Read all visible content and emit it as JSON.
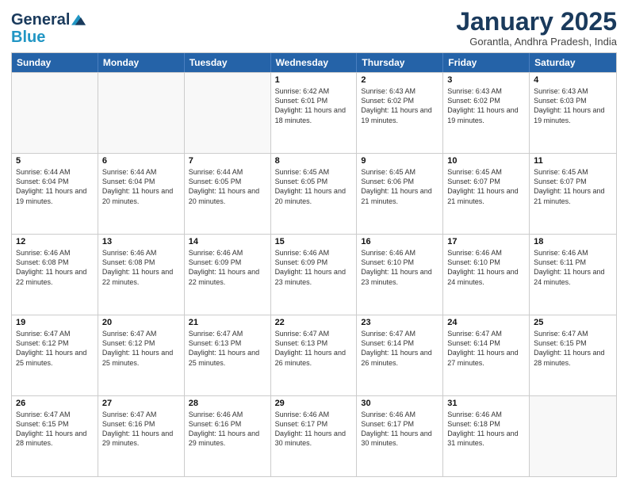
{
  "logo": {
    "line1": "General",
    "line2": "Blue"
  },
  "title": "January 2025",
  "subtitle": "Gorantla, Andhra Pradesh, India",
  "days_of_week": [
    "Sunday",
    "Monday",
    "Tuesday",
    "Wednesday",
    "Thursday",
    "Friday",
    "Saturday"
  ],
  "weeks": [
    [
      {
        "day": "",
        "info": "",
        "empty": true
      },
      {
        "day": "",
        "info": "",
        "empty": true
      },
      {
        "day": "",
        "info": "",
        "empty": true
      },
      {
        "day": "1",
        "info": "Sunrise: 6:42 AM\nSunset: 6:01 PM\nDaylight: 11 hours and 18 minutes."
      },
      {
        "day": "2",
        "info": "Sunrise: 6:43 AM\nSunset: 6:02 PM\nDaylight: 11 hours and 19 minutes."
      },
      {
        "day": "3",
        "info": "Sunrise: 6:43 AM\nSunset: 6:02 PM\nDaylight: 11 hours and 19 minutes."
      },
      {
        "day": "4",
        "info": "Sunrise: 6:43 AM\nSunset: 6:03 PM\nDaylight: 11 hours and 19 minutes."
      }
    ],
    [
      {
        "day": "5",
        "info": "Sunrise: 6:44 AM\nSunset: 6:04 PM\nDaylight: 11 hours and 19 minutes."
      },
      {
        "day": "6",
        "info": "Sunrise: 6:44 AM\nSunset: 6:04 PM\nDaylight: 11 hours and 20 minutes."
      },
      {
        "day": "7",
        "info": "Sunrise: 6:44 AM\nSunset: 6:05 PM\nDaylight: 11 hours and 20 minutes."
      },
      {
        "day": "8",
        "info": "Sunrise: 6:45 AM\nSunset: 6:05 PM\nDaylight: 11 hours and 20 minutes."
      },
      {
        "day": "9",
        "info": "Sunrise: 6:45 AM\nSunset: 6:06 PM\nDaylight: 11 hours and 21 minutes."
      },
      {
        "day": "10",
        "info": "Sunrise: 6:45 AM\nSunset: 6:07 PM\nDaylight: 11 hours and 21 minutes."
      },
      {
        "day": "11",
        "info": "Sunrise: 6:45 AM\nSunset: 6:07 PM\nDaylight: 11 hours and 21 minutes."
      }
    ],
    [
      {
        "day": "12",
        "info": "Sunrise: 6:46 AM\nSunset: 6:08 PM\nDaylight: 11 hours and 22 minutes."
      },
      {
        "day": "13",
        "info": "Sunrise: 6:46 AM\nSunset: 6:08 PM\nDaylight: 11 hours and 22 minutes."
      },
      {
        "day": "14",
        "info": "Sunrise: 6:46 AM\nSunset: 6:09 PM\nDaylight: 11 hours and 22 minutes."
      },
      {
        "day": "15",
        "info": "Sunrise: 6:46 AM\nSunset: 6:09 PM\nDaylight: 11 hours and 23 minutes."
      },
      {
        "day": "16",
        "info": "Sunrise: 6:46 AM\nSunset: 6:10 PM\nDaylight: 11 hours and 23 minutes."
      },
      {
        "day": "17",
        "info": "Sunrise: 6:46 AM\nSunset: 6:10 PM\nDaylight: 11 hours and 24 minutes."
      },
      {
        "day": "18",
        "info": "Sunrise: 6:46 AM\nSunset: 6:11 PM\nDaylight: 11 hours and 24 minutes."
      }
    ],
    [
      {
        "day": "19",
        "info": "Sunrise: 6:47 AM\nSunset: 6:12 PM\nDaylight: 11 hours and 25 minutes."
      },
      {
        "day": "20",
        "info": "Sunrise: 6:47 AM\nSunset: 6:12 PM\nDaylight: 11 hours and 25 minutes."
      },
      {
        "day": "21",
        "info": "Sunrise: 6:47 AM\nSunset: 6:13 PM\nDaylight: 11 hours and 25 minutes."
      },
      {
        "day": "22",
        "info": "Sunrise: 6:47 AM\nSunset: 6:13 PM\nDaylight: 11 hours and 26 minutes."
      },
      {
        "day": "23",
        "info": "Sunrise: 6:47 AM\nSunset: 6:14 PM\nDaylight: 11 hours and 26 minutes."
      },
      {
        "day": "24",
        "info": "Sunrise: 6:47 AM\nSunset: 6:14 PM\nDaylight: 11 hours and 27 minutes."
      },
      {
        "day": "25",
        "info": "Sunrise: 6:47 AM\nSunset: 6:15 PM\nDaylight: 11 hours and 28 minutes."
      }
    ],
    [
      {
        "day": "26",
        "info": "Sunrise: 6:47 AM\nSunset: 6:15 PM\nDaylight: 11 hours and 28 minutes."
      },
      {
        "day": "27",
        "info": "Sunrise: 6:47 AM\nSunset: 6:16 PM\nDaylight: 11 hours and 29 minutes."
      },
      {
        "day": "28",
        "info": "Sunrise: 6:46 AM\nSunset: 6:16 PM\nDaylight: 11 hours and 29 minutes."
      },
      {
        "day": "29",
        "info": "Sunrise: 6:46 AM\nSunset: 6:17 PM\nDaylight: 11 hours and 30 minutes."
      },
      {
        "day": "30",
        "info": "Sunrise: 6:46 AM\nSunset: 6:17 PM\nDaylight: 11 hours and 30 minutes."
      },
      {
        "day": "31",
        "info": "Sunrise: 6:46 AM\nSunset: 6:18 PM\nDaylight: 11 hours and 31 minutes."
      },
      {
        "day": "",
        "info": "",
        "empty": true
      }
    ]
  ]
}
